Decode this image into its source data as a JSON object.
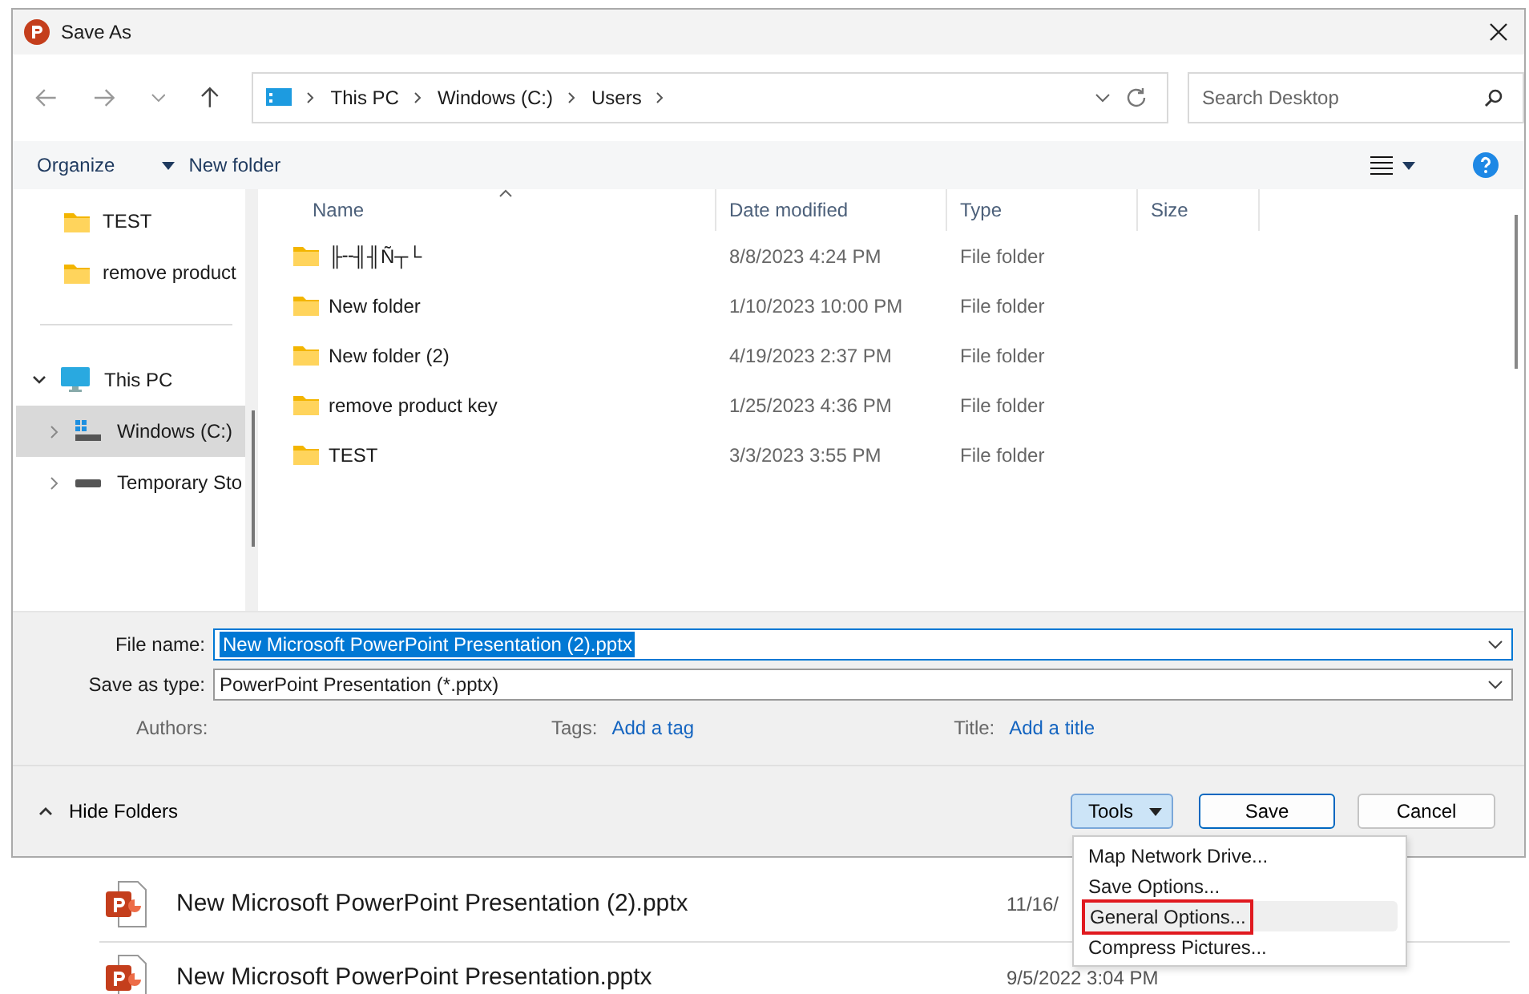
{
  "window": {
    "title": "Save As"
  },
  "address": {
    "path": [
      "This PC",
      "Windows (C:)",
      "Users"
    ]
  },
  "search": {
    "placeholder": "Search Desktop"
  },
  "toolbar": {
    "items": [
      "Organize",
      "New folder"
    ]
  },
  "sidebar": {
    "quick_items": [
      {
        "label": "TEST",
        "selected": false
      },
      {
        "label": "remove product",
        "selected": false
      }
    ],
    "tree": [
      {
        "label": "This PC",
        "kind": "pc",
        "selected": false,
        "expanded": true,
        "children": [
          {
            "label": "Windows (C:)",
            "kind": "windows-drive",
            "selected": true,
            "expanded": false
          },
          {
            "label": "Temporary Sto",
            "kind": "drive",
            "selected": false,
            "expanded": false
          }
        ]
      }
    ]
  },
  "table": {
    "columns": [
      "Name",
      "Date modified",
      "Type",
      "Size"
    ],
    "rows": [
      {
        "name": "╟╌╢╢Ñ┬└",
        "date": "8/8/2023 4:24 PM",
        "type": "File folder"
      },
      {
        "name": "New folder",
        "date": "1/10/2023 10:00 PM",
        "type": "File folder"
      },
      {
        "name": "New folder (2)",
        "date": "4/19/2023 2:37 PM",
        "type": "File folder"
      },
      {
        "name": "remove product key",
        "date": "1/25/2023 4:36 PM",
        "type": "File folder"
      },
      {
        "name": "TEST",
        "date": "3/3/2023 3:55 PM",
        "type": "File folder"
      }
    ]
  },
  "form": {
    "file_name": {
      "label": "File name:",
      "value": "New Microsoft PowerPoint Presentation (2).pptx"
    },
    "save_as_type": {
      "label": "Save as type:",
      "value": "PowerPoint Presentation (*.pptx)"
    },
    "authors": {
      "label": "Authors:"
    },
    "tags": {
      "label": "Tags:",
      "link": "Add a tag"
    },
    "title": {
      "label": "Title:",
      "link": "Add a title"
    }
  },
  "footer": {
    "hide_folders": "Hide Folders",
    "tools": "Tools",
    "save": "Save",
    "cancel": "Cancel"
  },
  "tools_menu": [
    {
      "label": "Map Network Drive...",
      "selected": false
    },
    {
      "label": "Save Options...",
      "selected": false
    },
    {
      "label": "General Options...",
      "selected": true
    },
    {
      "label": "Compress Pictures...",
      "selected": false
    }
  ],
  "background_files": [
    {
      "name": "New Microsoft PowerPoint Presentation (2).pptx",
      "date": "11/16/"
    },
    {
      "name": "New Microsoft PowerPoint Presentation.pptx",
      "date": "9/5/2022 3:04 PM"
    }
  ]
}
